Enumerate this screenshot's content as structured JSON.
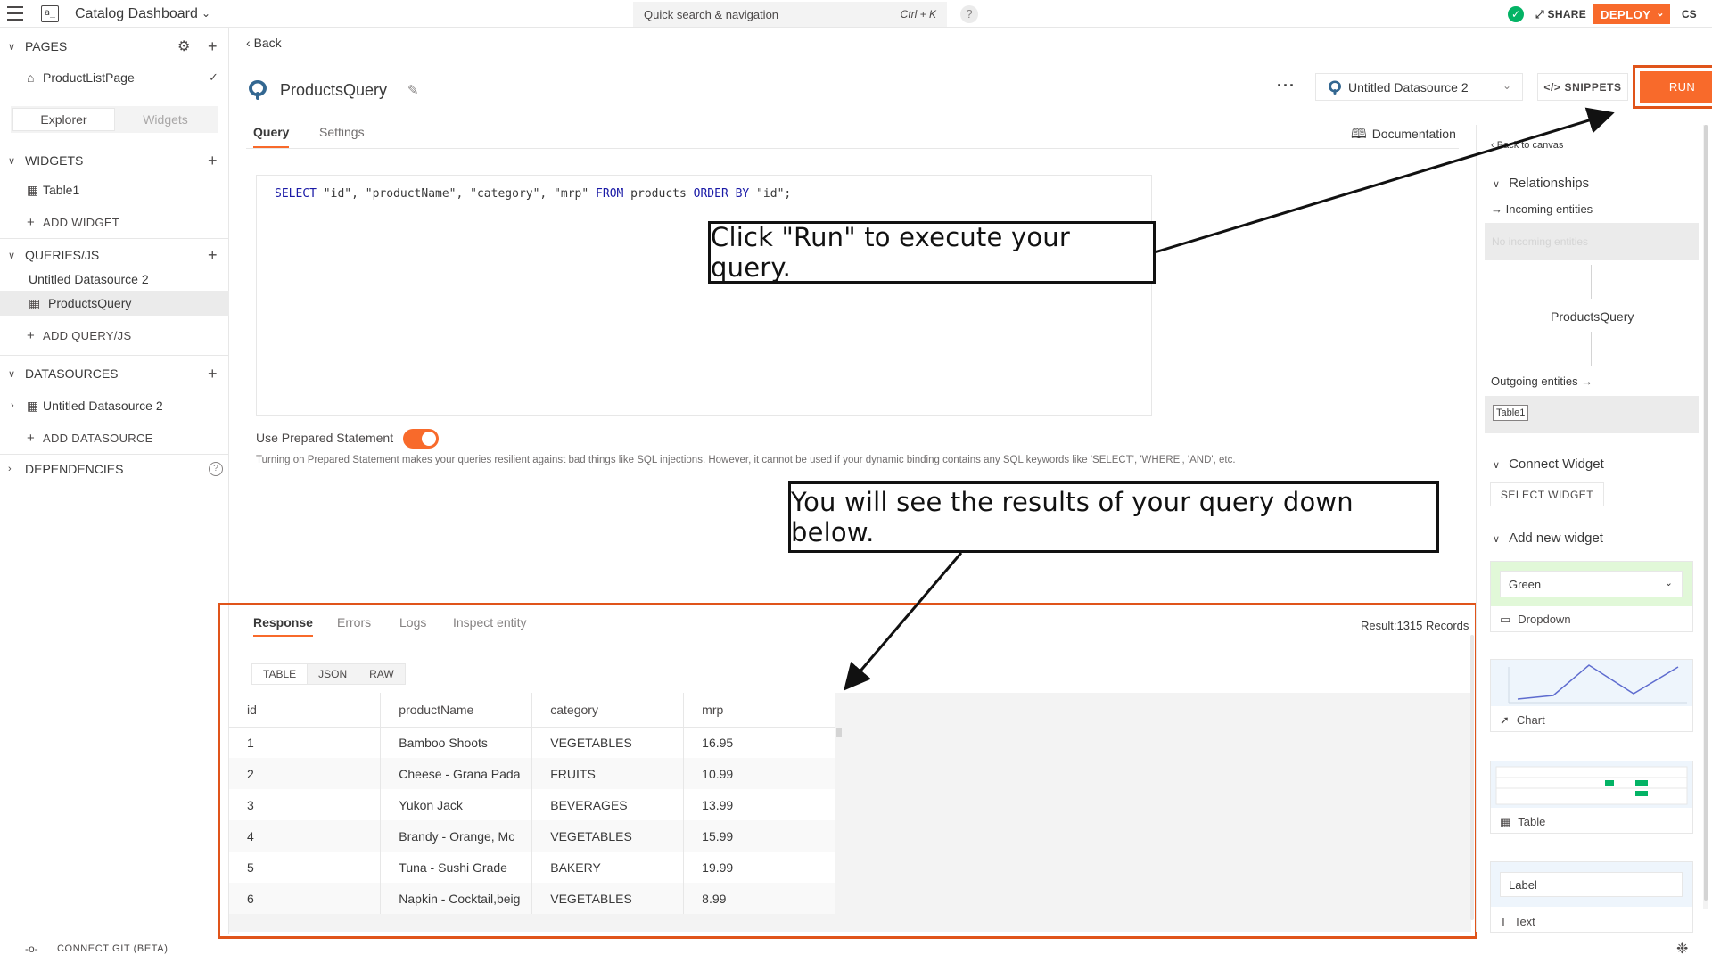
{
  "header": {
    "app_icon_text": "a_",
    "app_name": "Catalog Dashboard",
    "quick_search": "Quick search & navigation",
    "quick_search_shortcut": "Ctrl + K",
    "help": "?",
    "share": "SHARE",
    "deploy": "DEPLOY",
    "avatar_initials": "CS"
  },
  "sidebar": {
    "pages_label": "PAGES",
    "page_item": "ProductListPage",
    "tab_explorer": "Explorer",
    "tab_widgets": "Widgets",
    "widgets_label": "WIDGETS",
    "widget_item": "Table1",
    "add_widget": "ADD WIDGET",
    "queries_label": "QUERIES/JS",
    "query_group": "Untitled Datasource 2",
    "query_item": "ProductsQuery",
    "add_query": "ADD QUERY/JS",
    "datasources_label": "DATASOURCES",
    "datasource_item": "Untitled Datasource 2",
    "add_datasource": "ADD DATASOURCE",
    "dependencies_label": "DEPENDENCIES"
  },
  "bottombar": {
    "connect_git": "CONNECT GIT (BETA)"
  },
  "editor": {
    "back": "Back",
    "query_name": "ProductsQuery",
    "datasource": "Untitled Datasource 2",
    "snippets": "SNIPPETS",
    "run": "RUN",
    "tab_query": "Query",
    "tab_settings": "Settings",
    "documentation": "Documentation",
    "sql_select": "SELECT",
    "sql_cols": " \"id\", \"productName\", \"category\", \"mrp\" ",
    "sql_from": "FROM",
    "sql_table": " products ",
    "sql_order": "ORDER BY",
    "sql_tail": " \"id\";",
    "prepared_label": "Use Prepared Statement",
    "prepared_on": true,
    "prepared_help": "Turning on Prepared Statement makes your queries resilient against bad things like SQL injections. However, it cannot be used if your dynamic binding contains any SQL keywords like 'SELECT', 'WHERE', 'AND', etc."
  },
  "response": {
    "tab_response": "Response",
    "tab_errors": "Errors",
    "tab_logs": "Logs",
    "tab_inspect": "Inspect entity",
    "result_count": "Result:1315 Records",
    "view_table": "TABLE",
    "view_json": "JSON",
    "view_raw": "RAW",
    "columns": [
      "id",
      "productName",
      "category",
      "mrp"
    ],
    "rows": [
      [
        "1",
        "Bamboo Shoots",
        "VEGETABLES",
        "16.95"
      ],
      [
        "2",
        "Cheese - Grana Pada",
        "FRUITS",
        "10.99"
      ],
      [
        "3",
        "Yukon Jack",
        "BEVERAGES",
        "13.99"
      ],
      [
        "4",
        "Brandy - Orange, Mc",
        "VEGETABLES",
        "15.99"
      ],
      [
        "5",
        "Tuna - Sushi Grade",
        "BAKERY",
        "19.99"
      ],
      [
        "6",
        "Napkin - Cocktail,beig",
        "VEGETABLES",
        "8.99"
      ]
    ]
  },
  "right_panel": {
    "back_to_canvas": "Back to canvas",
    "relationships": "Relationships",
    "incoming_entities": "Incoming entities",
    "no_incoming": "No incoming entities",
    "current_entity": "ProductsQuery",
    "outgoing_entities": "Outgoing entities",
    "outgoing_chip": "Table1",
    "connect_widget": "Connect Widget",
    "select_widget": "SELECT WIDGET",
    "add_new_widget": "Add new widget",
    "dropdown_value": "Green",
    "dropdown_label": "Dropdown",
    "chart_label": "Chart",
    "table_label": "Table",
    "label_value": "Label",
    "text_label": "Text"
  },
  "callouts": {
    "run_hint": "Click \"Run\" to execute your query.",
    "results_hint": "You will see the results of your query down below."
  },
  "colors": {
    "accent": "#f86a2b",
    "highlight_border": "#e0541a",
    "success": "#03b365"
  }
}
